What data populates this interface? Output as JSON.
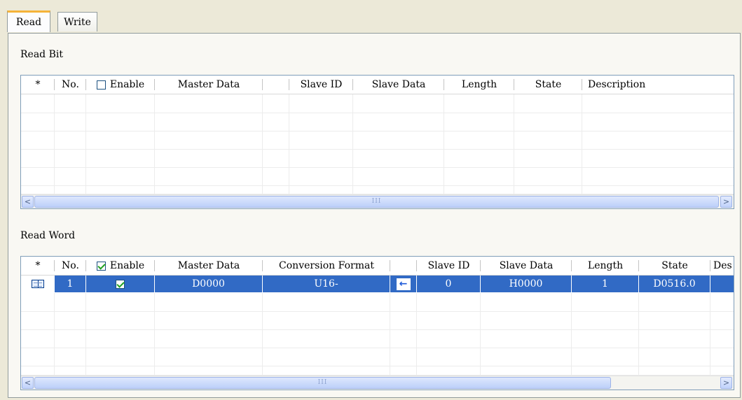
{
  "tabs": [
    {
      "label": "Read",
      "active": true
    },
    {
      "label": "Write",
      "active": false
    }
  ],
  "read_bit": {
    "title": "Read Bit",
    "headers": {
      "star": "*",
      "no": "No.",
      "enable": "Enable",
      "master_data": "Master Data",
      "slave_id": "Slave ID",
      "slave_data": "Slave Data",
      "length": "Length",
      "state": "State",
      "description": "Description"
    },
    "enable_checked": false,
    "scroll_thumb_text": "III"
  },
  "read_word": {
    "title": "Read Word",
    "headers": {
      "star": "*",
      "no": "No.",
      "enable": "Enable",
      "master_data": "Master Data",
      "conversion_format": "Conversion Format",
      "slave_id": "Slave ID",
      "slave_data": "Slave Data",
      "length": "Length",
      "state": "State",
      "description": "Des"
    },
    "enable_checked": true,
    "rows": [
      {
        "no": "1",
        "enabled": true,
        "master_data": "D0000",
        "conversion_format": "U16-",
        "direction_icon": "arrow-left-icon",
        "slave_id": "0",
        "slave_data": "H0000",
        "length": "1",
        "state": "D0516.0",
        "selected": true
      }
    ],
    "scroll_thumb_text": "III"
  },
  "scroll_left_glyph": "<",
  "scroll_right_glyph": ">",
  "colors": {
    "selection": "#316ac5",
    "tab_accent": "#f5b33a",
    "arrow": "#1d5ad9"
  }
}
